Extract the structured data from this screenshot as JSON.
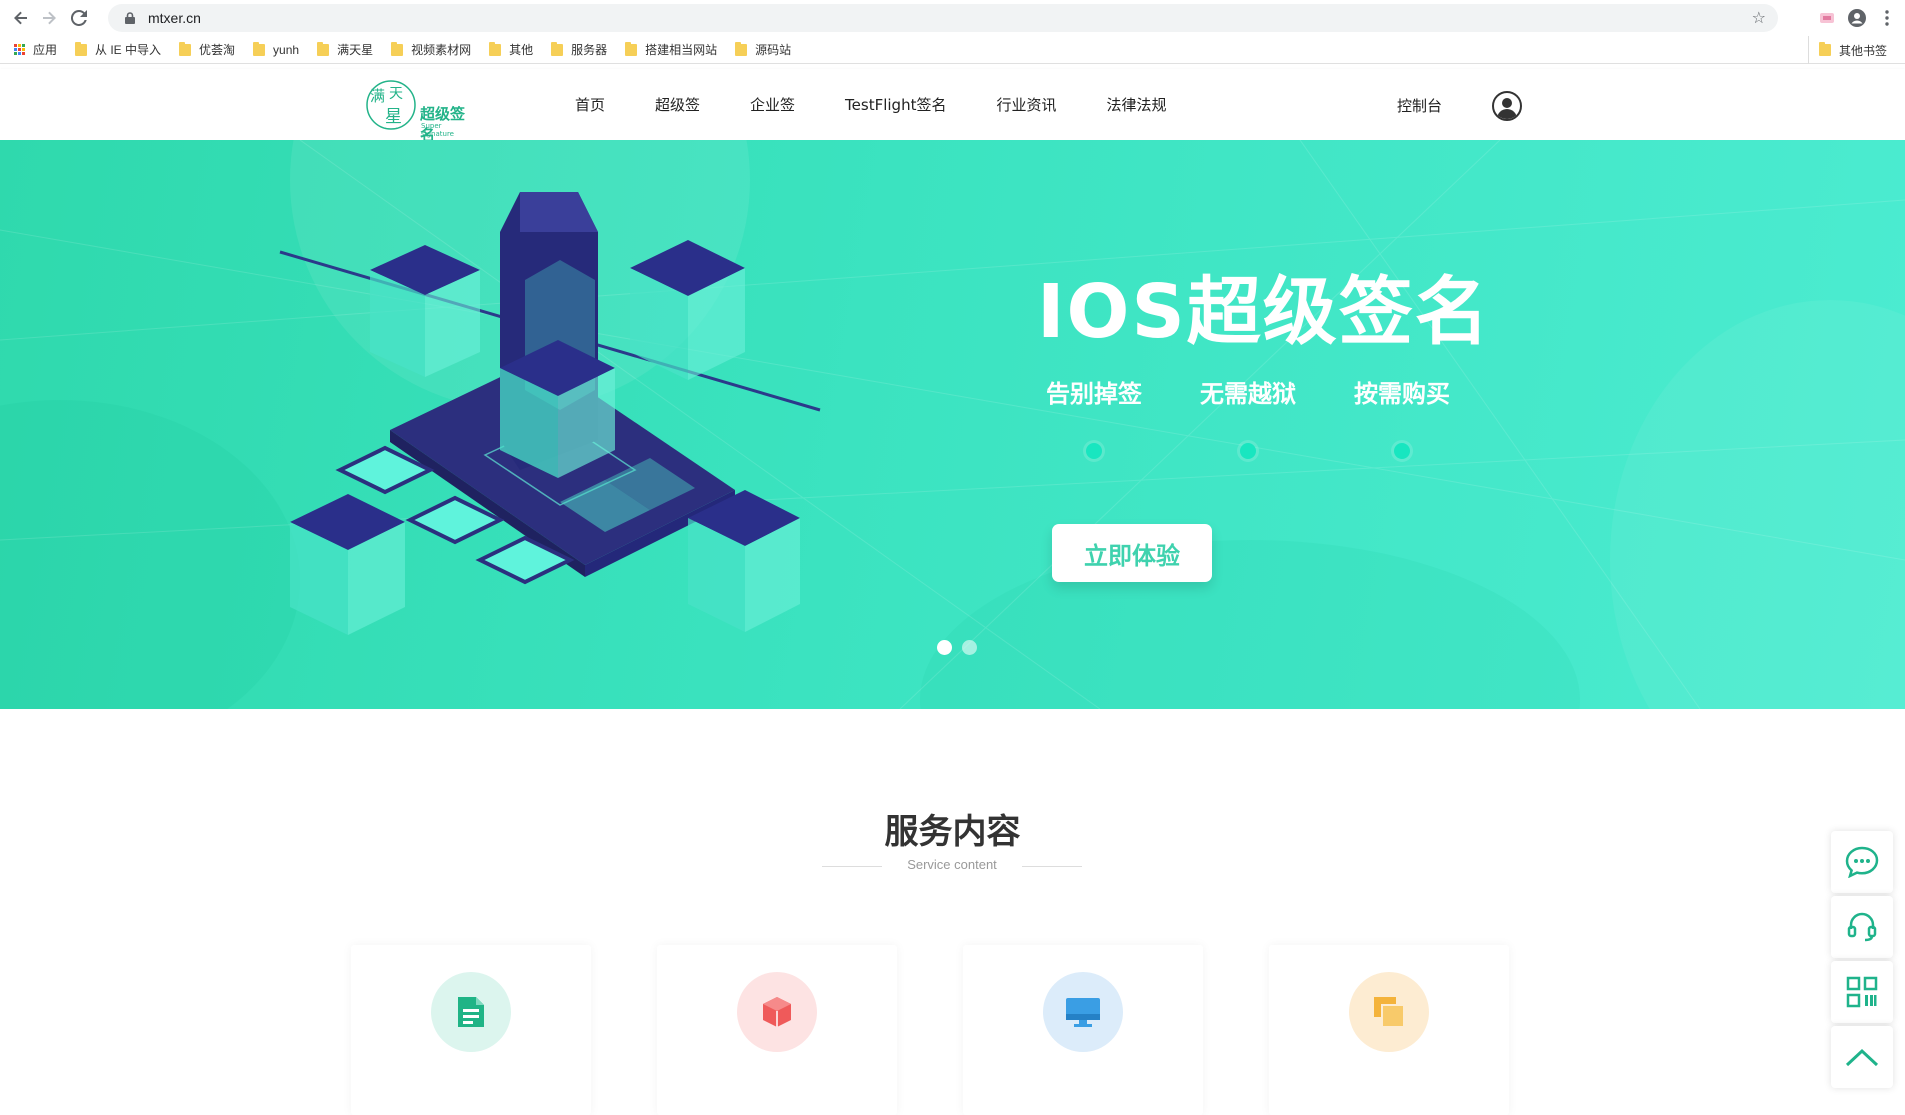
{
  "browser": {
    "url": "mtxer.cn",
    "bookmarks": [
      {
        "label": "应用",
        "type": "apps"
      },
      {
        "label": "从 IE 中导入",
        "type": "folder"
      },
      {
        "label": "优荟淘",
        "type": "folder"
      },
      {
        "label": "yunh",
        "type": "folder"
      },
      {
        "label": "满天星",
        "type": "folder"
      },
      {
        "label": "视频素材网",
        "type": "folder"
      },
      {
        "label": "其他",
        "type": "folder"
      },
      {
        "label": "服务器",
        "type": "folder"
      },
      {
        "label": "搭建相当网站",
        "type": "folder"
      },
      {
        "label": "源码站",
        "type": "folder"
      }
    ],
    "other_bookmarks": "其他书签"
  },
  "header": {
    "logo_text": "超级签名",
    "logo_sub": "Super signature",
    "nav": [
      "首页",
      "超级签",
      "企业签",
      "TestFlight签名",
      "行业资讯",
      "法律法规"
    ],
    "console_label": "控制台"
  },
  "hero": {
    "title": "IOS超级签名",
    "features": [
      "告别掉签",
      "无需越狱",
      "按需购买"
    ],
    "cta_label": "立即体验",
    "slide_count": 2,
    "active_slide": 1
  },
  "services": {
    "title": "服务内容",
    "subtitle": "Service content",
    "cards": [
      {
        "icon": "document-icon",
        "bg": "#dcf5ee",
        "fg": "#20b486"
      },
      {
        "icon": "cube-icon",
        "bg": "#fde3e3",
        "fg": "#ef5a5a"
      },
      {
        "icon": "monitor-icon",
        "bg": "#dcecfa",
        "fg": "#3a9ee4"
      },
      {
        "icon": "layers-icon",
        "bg": "#fdecd2",
        "fg": "#f4b33b"
      }
    ]
  },
  "float_bar": [
    "chat-icon",
    "headset-icon",
    "qrcode-icon",
    "back-to-top-icon"
  ],
  "colors": {
    "accent": "#23b389",
    "hero_start": "#2fd9ad",
    "hero_end": "#4cecd1",
    "float_icon": "#1fb38b"
  }
}
